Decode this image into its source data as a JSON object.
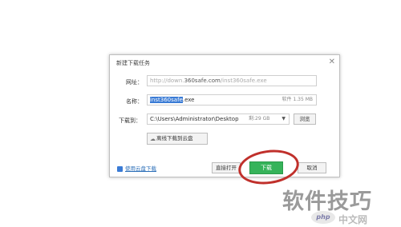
{
  "dialog": {
    "title": "新建下载任务",
    "close_icon": "close-icon"
  },
  "url_row": {
    "label": "网址：",
    "value_prefix": "http://down.",
    "value_host": "360safe.com",
    "value_suffix": "/inst360safe.exe"
  },
  "name_row": {
    "label": "名称：",
    "selected_text": "inst360safe",
    "extension": ".exe",
    "size_note": "软件 1.35 MB"
  },
  "path_row": {
    "label": "下载到：",
    "path": "C:\\Users\\Administrator\\Desktop",
    "free_space": "剩:29 GB",
    "dropdown_icon": "chevron-down-icon",
    "browse_label": "浏览"
  },
  "cloud_button": {
    "label": "离线下载到云盘",
    "icon": "cloud-icon"
  },
  "footer": {
    "link_label": "使用云盘下载",
    "open_label": "直接打开",
    "download_label": "下载",
    "cancel_label": "取消"
  },
  "overlay": {
    "watermark": "软件技巧",
    "site_logo": "php",
    "site_name": "中文网"
  },
  "colors": {
    "download_green": "#36b35a",
    "selection_blue": "#3a7bd5",
    "annotation_red": "#c0302b"
  }
}
